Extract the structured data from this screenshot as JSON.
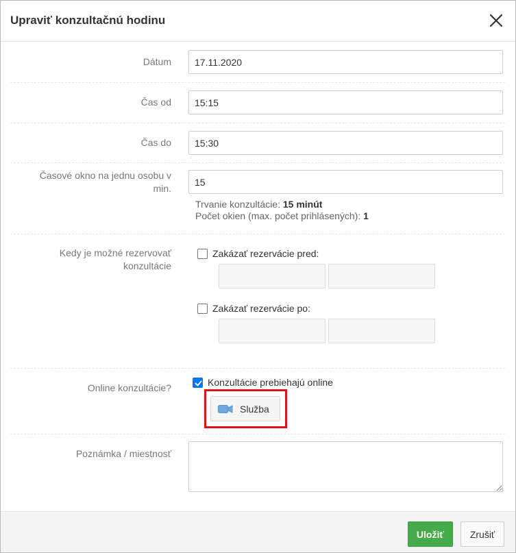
{
  "modal": {
    "title": "Upraviť konzultačnú hodinu",
    "close_icon": "close-icon"
  },
  "form": {
    "date": {
      "label": "Dátum",
      "value": "17.11.2020"
    },
    "time_from": {
      "label": "Čas od",
      "value": "15:15"
    },
    "time_to": {
      "label": "Čas do",
      "value": "15:30"
    },
    "slot": {
      "label_line1": "Časové okno na jednu osobu v",
      "label_line2": "min.",
      "value": "15",
      "duration_label": "Trvanie konzultácie: ",
      "duration_value": "15 minút",
      "windows_label": "Počet okien (max. počet prihlásených): ",
      "windows_value": "1"
    },
    "booking": {
      "label_line1": "Kedy je možné rezervovať",
      "label_line2": "konzultácie",
      "disable_before": {
        "label": "Zakázať rezervácie pred:",
        "checked": false,
        "date": "",
        "time": ""
      },
      "disable_after": {
        "label": "Zakázať rezervácie po:",
        "checked": false,
        "date": "",
        "time": ""
      }
    },
    "online": {
      "label": "Online konzultácie?",
      "checkbox_label": "Konzultácie prebiehajú online",
      "checked": true,
      "service_button": "Služba",
      "service_icon": "video-camera-icon"
    },
    "note": {
      "label": "Poznámka / miestnosť",
      "value": ""
    }
  },
  "footer": {
    "save": "Uložiť",
    "cancel": "Zrušiť"
  },
  "colors": {
    "save_button": "#45ab4a",
    "checkbox_accent": "#0075ff",
    "highlight": "#e0121b",
    "camera_icon": "#6fa8dc"
  }
}
